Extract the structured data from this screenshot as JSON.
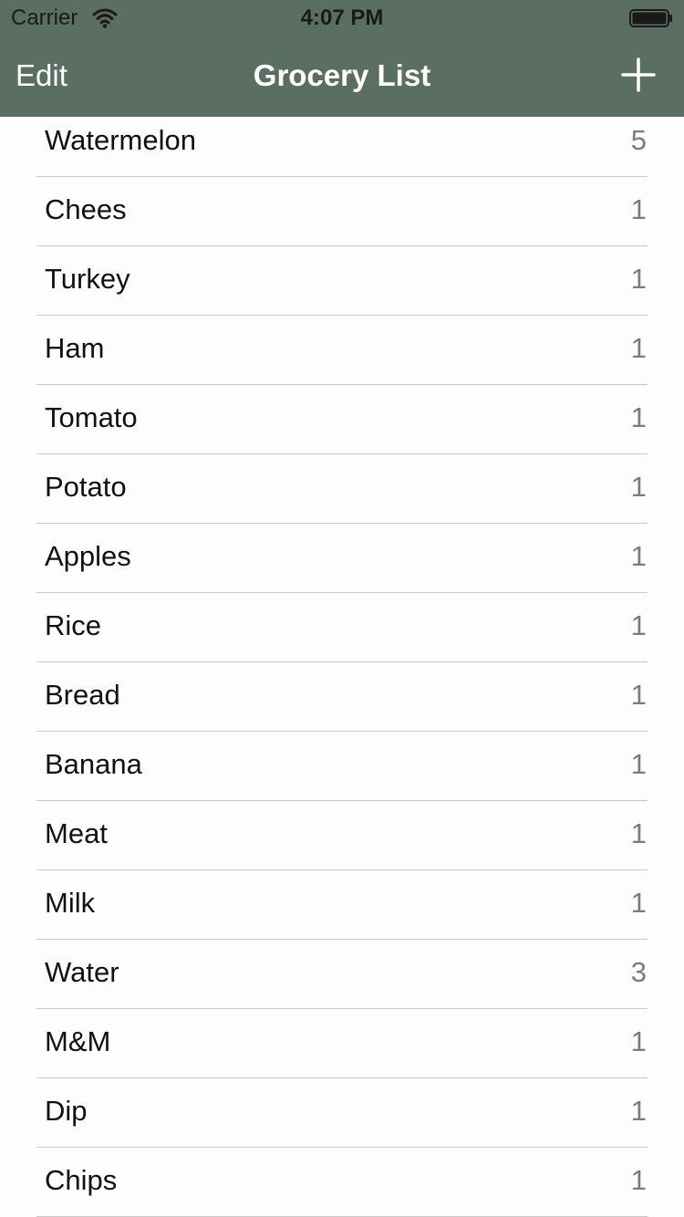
{
  "status_bar": {
    "carrier": "Carrier",
    "time": "4:07 PM",
    "wifi_icon": "wifi-icon",
    "battery_icon": "battery-icon"
  },
  "nav": {
    "edit_label": "Edit",
    "title": "Grocery List",
    "add_icon": "plus-icon",
    "background_color": "#5a6e63"
  },
  "items": [
    {
      "name": "Watermelon",
      "qty": "5"
    },
    {
      "name": "Chees",
      "qty": "1"
    },
    {
      "name": "Turkey",
      "qty": "1"
    },
    {
      "name": "Ham",
      "qty": "1"
    },
    {
      "name": "Tomato",
      "qty": "1"
    },
    {
      "name": "Potato",
      "qty": "1"
    },
    {
      "name": "Apples",
      "qty": "1"
    },
    {
      "name": "Rice",
      "qty": "1"
    },
    {
      "name": "Bread",
      "qty": "1"
    },
    {
      "name": "Banana",
      "qty": "1"
    },
    {
      "name": "Meat",
      "qty": "1"
    },
    {
      "name": "Milk",
      "qty": "1"
    },
    {
      "name": "Water",
      "qty": "3"
    },
    {
      "name": "M&M",
      "qty": "1"
    },
    {
      "name": "Dip",
      "qty": "1"
    },
    {
      "name": "Chips",
      "qty": "1"
    }
  ]
}
